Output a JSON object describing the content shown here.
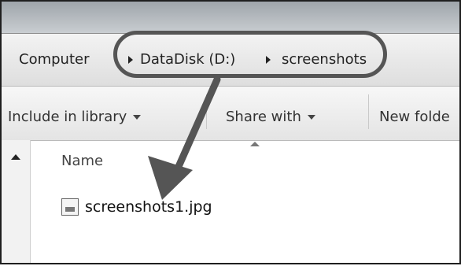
{
  "address": {
    "crumbs": [
      "Computer",
      "DataDisk (D:)",
      "screenshots"
    ]
  },
  "toolbar": {
    "include": "Include in library",
    "share": "Share with",
    "newfolder": "New folde"
  },
  "list": {
    "column_name": "Name",
    "files": [
      "screenshots1.jpg"
    ]
  },
  "icons": [
    "breadcrumb-arrow-icon",
    "dropdown-caret-icon",
    "scroll-up-icon",
    "sort-arrow-icon",
    "image-file-icon",
    "annotation-arrow-icon"
  ],
  "colors": {
    "annotation": "#555555"
  }
}
